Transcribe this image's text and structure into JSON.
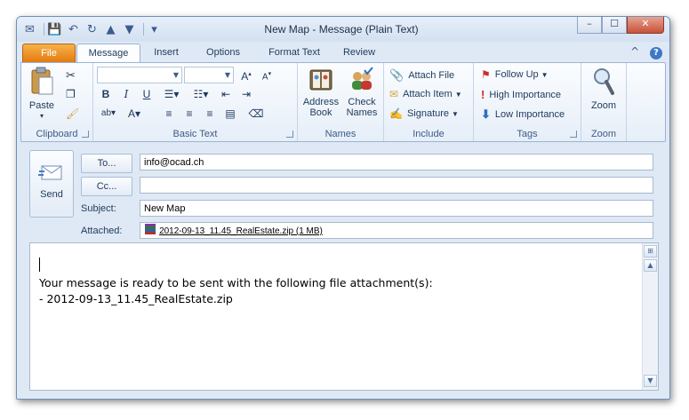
{
  "window": {
    "title": "New Map  -  Message (Plain Text)"
  },
  "tabs": [
    {
      "label": "File"
    },
    {
      "label": "Message"
    },
    {
      "label": "Insert"
    },
    {
      "label": "Options"
    },
    {
      "label": "Format Text"
    },
    {
      "label": "Review"
    }
  ],
  "ribbon": {
    "clipboard": {
      "paste": "Paste",
      "label": "Clipboard"
    },
    "basic_text": {
      "label": "Basic Text"
    },
    "names": {
      "address_book_1": "Address",
      "address_book_2": "Book",
      "check_names_1": "Check",
      "check_names_2": "Names",
      "label": "Names"
    },
    "include": {
      "attach_file": "Attach File",
      "attach_item": "Attach Item",
      "signature": "Signature",
      "label": "Include"
    },
    "tags": {
      "follow_up": "Follow Up",
      "high_importance": "High Importance",
      "low_importance": "Low Importance",
      "label": "Tags"
    },
    "zoom": {
      "button": "Zoom",
      "label": "Zoom"
    }
  },
  "compose": {
    "send": "Send",
    "to_button": "To...",
    "cc_button": "Cc...",
    "subject_label": "Subject:",
    "attached_label": "Attached:",
    "to_value": "info@ocad.ch",
    "cc_value": "",
    "subject_value": "New Map",
    "attachment": "2012-09-13_11.45_RealEstate.zip (1 MB)"
  },
  "body": {
    "line1": "Your message is ready to be sent with the following file attachment(s):",
    "line2": "- 2012-09-13_11.45_RealEstate.zip"
  }
}
